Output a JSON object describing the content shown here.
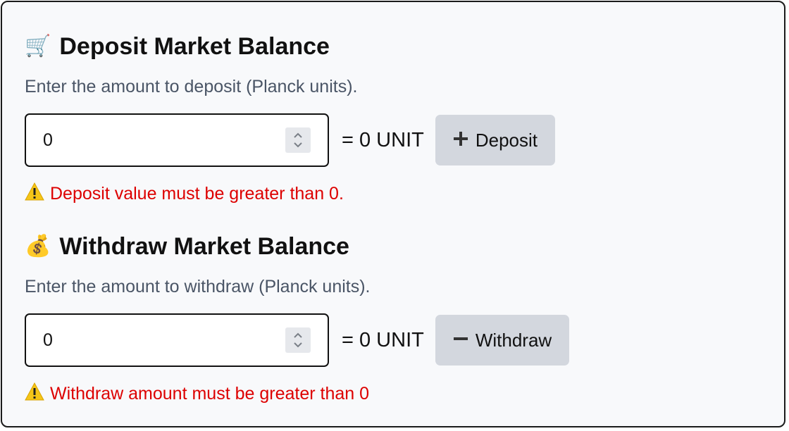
{
  "deposit": {
    "icon": "shopping-cart-icon",
    "title": "Deposit Market Balance",
    "help": "Enter the amount to deposit (Planck units).",
    "input_value": "0",
    "conversion": "= 0 UNIT",
    "button_icon": "plus-icon",
    "button_label": "Deposit",
    "error": "Deposit value must be greater than 0."
  },
  "withdraw": {
    "icon": "money-bag-icon",
    "title": "Withdraw Market Balance",
    "help": "Enter the amount to withdraw (Planck units).",
    "input_value": "0",
    "conversion": "= 0 UNIT",
    "button_icon": "minus-icon",
    "button_label": "Withdraw",
    "error": "Withdraw amount must be greater than 0"
  },
  "colors": {
    "panel_bg": "#f8f9fb",
    "button_bg": "#d3d7de",
    "error": "#dd0000",
    "help_text": "#4a5566"
  }
}
